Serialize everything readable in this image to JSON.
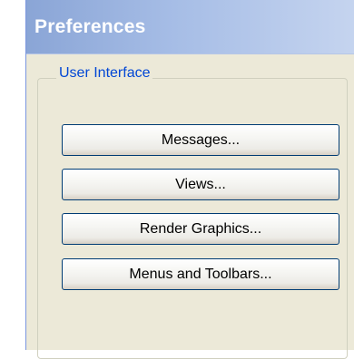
{
  "window": {
    "title": "Preferences"
  },
  "group": {
    "label": "User Interface"
  },
  "buttons": [
    {
      "label": "Messages..."
    },
    {
      "label": "Views..."
    },
    {
      "label": "Render Graphics..."
    },
    {
      "label": "Menus and Toolbars..."
    }
  ]
}
